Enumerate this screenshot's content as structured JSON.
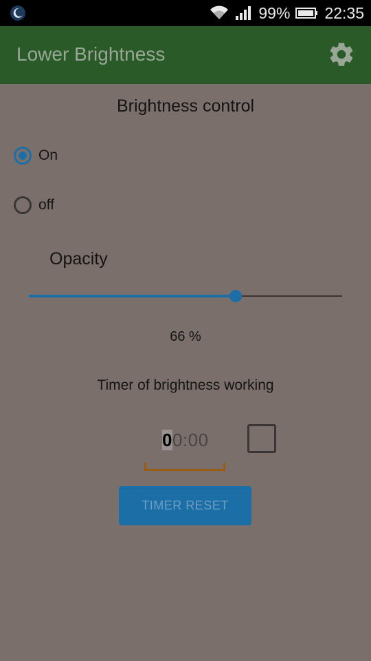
{
  "status_bar": {
    "battery_percent": "99%",
    "time": "22:35"
  },
  "app_bar": {
    "title": "Lower Brightness",
    "settings_icon": "gear-icon"
  },
  "main": {
    "section_title": "Brightness control",
    "radio_on_label": "On",
    "radio_off_label": "off",
    "selected": "On",
    "opacity_label": "Opacity",
    "opacity_value": 66,
    "opacity_text": "66 %",
    "timer_label": "Timer of brightness working",
    "timer_first_digit": "0",
    "timer_rest": "0:00",
    "timer_checkbox_checked": false,
    "reset_button_label": "TIMER RESET"
  },
  "colors": {
    "accent": "#1b6fa6",
    "appbar": "#2a5a28",
    "overlay_background": "#7b6f6c"
  }
}
